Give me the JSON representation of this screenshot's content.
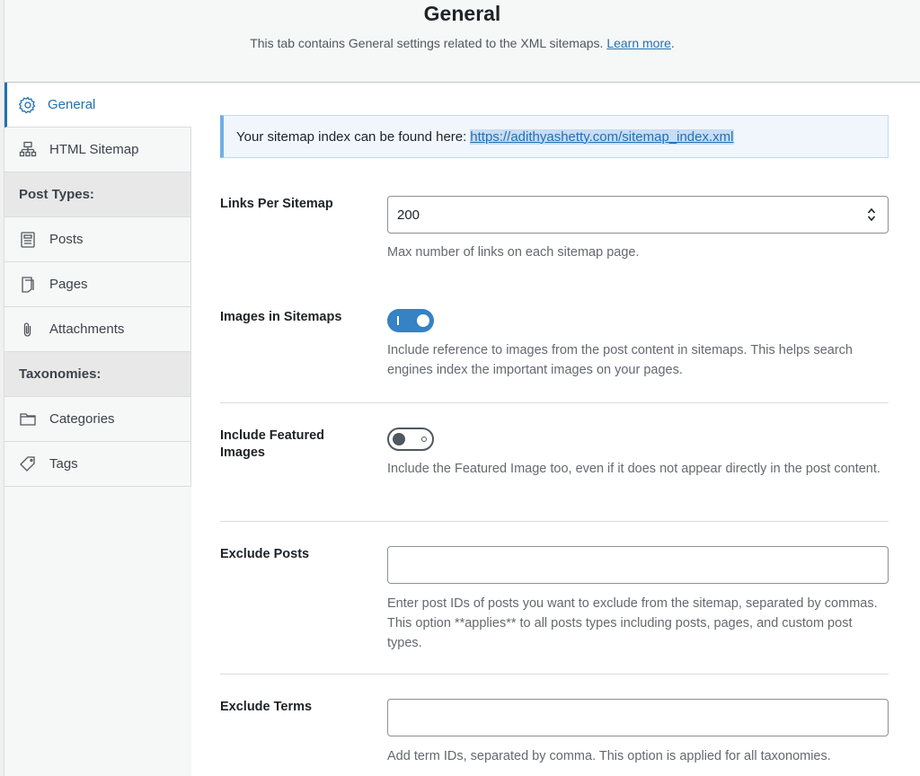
{
  "header": {
    "title": "General",
    "description": "This tab contains General settings related to the XML sitemaps.",
    "learn_more": "Learn more",
    "period": "."
  },
  "sidebar": {
    "items": [
      {
        "label": "General",
        "icon": "gear-icon",
        "active": true
      },
      {
        "label": "HTML Sitemap",
        "icon": "sitemap-icon"
      }
    ],
    "groups": {
      "post_types": {
        "label": "Post Types:",
        "items": [
          {
            "label": "Posts",
            "icon": "post-icon"
          },
          {
            "label": "Pages",
            "icon": "page-icon"
          },
          {
            "label": "Attachments",
            "icon": "paperclip-icon"
          }
        ]
      },
      "taxonomies": {
        "label": "Taxonomies:",
        "items": [
          {
            "label": "Categories",
            "icon": "folder-icon"
          },
          {
            "label": "Tags",
            "icon": "tag-icon"
          }
        ]
      }
    }
  },
  "notice": {
    "text": "Your sitemap index can be found here:",
    "url": "https://adithyashetty.com/sitemap_index.xml"
  },
  "settings": {
    "links_per_sitemap": {
      "label": "Links Per Sitemap",
      "value": "200",
      "description": "Max number of links on each sitemap page."
    },
    "images_in_sitemaps": {
      "label": "Images in Sitemaps",
      "enabled": true,
      "description": "Include reference to images from the post content in sitemaps. This helps search engines index the important images on your pages."
    },
    "include_featured_images": {
      "label": "Include Featured Images",
      "enabled": false,
      "description": "Include the Featured Image too, even if it does not appear directly in the post content."
    },
    "exclude_posts": {
      "label": "Exclude Posts",
      "value": "",
      "description": "Enter post IDs of posts you want to exclude from the sitemap, separated by commas. This option **applies** to all posts types including posts, pages, and custom post types."
    },
    "exclude_terms": {
      "label": "Exclude Terms",
      "value": "",
      "description": "Add term IDs, separated by comma. This option is applied for all taxonomies."
    }
  },
  "colors": {
    "accent": "#2271b1",
    "toggle_on": "#3582c4"
  }
}
